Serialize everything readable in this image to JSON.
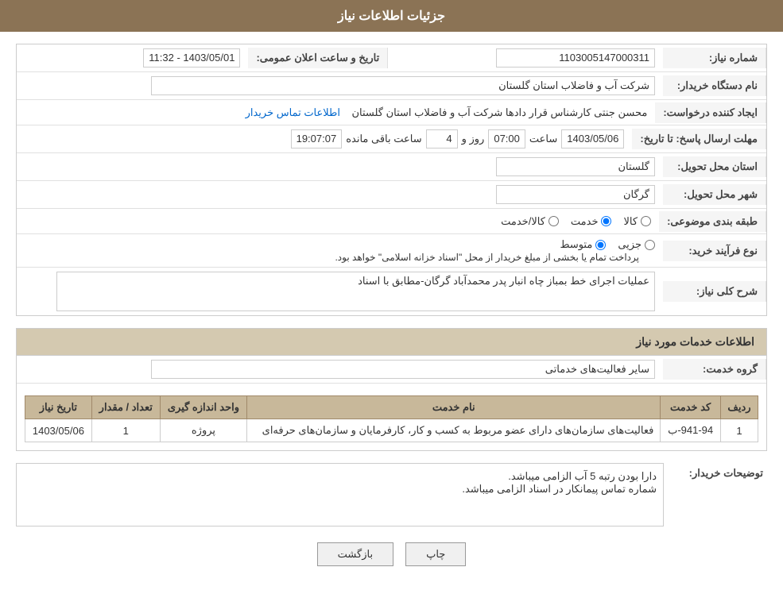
{
  "page": {
    "title": "جزئیات اطلاعات نیاز"
  },
  "header": {
    "title": "جزئیات اطلاعات نیاز"
  },
  "form": {
    "need_number_label": "شماره نیاز:",
    "need_number_value": "1103005147000311",
    "announcement_date_label": "تاریخ و ساعت اعلان عمومی:",
    "announcement_date_value": "1403/05/01 - 11:32",
    "buyer_org_label": "نام دستگاه خریدار:",
    "buyer_org_value": "شرکت آب و فاضلاب استان گلستان",
    "creator_label": "ایجاد کننده درخواست:",
    "creator_value": "محسن جنتی کارشناس قرار دادها شرکت آب و فاضلاب استان گلستان",
    "creator_link": "اطلاعات تماس خریدار",
    "reply_deadline_label": "مهلت ارسال پاسخ: تا تاریخ:",
    "reply_date": "1403/05/06",
    "reply_time_label": "ساعت",
    "reply_time": "07:00",
    "reply_day_label": "روز و",
    "reply_days": "4",
    "reply_remaining_label": "ساعت باقی مانده",
    "reply_remaining": "19:07:07",
    "province_label": "استان محل تحویل:",
    "province_value": "گلستان",
    "city_label": "شهر محل تحویل:",
    "city_value": "گرگان",
    "category_label": "طبقه بندی موضوعی:",
    "category_options": [
      "کالا",
      "خدمت",
      "کالا/خدمت"
    ],
    "category_selected": "خدمت",
    "purchase_type_label": "نوع فرآیند خرید:",
    "purchase_options": [
      "جزیی",
      "متوسط"
    ],
    "purchase_note": "پرداخت تمام یا بخشی از مبلغ خریدار از محل \"اسناد خزانه اسلامی\" خواهد بود.",
    "description_label": "شرح کلی نیاز:",
    "description_value": "عملیات اجرای خط بمباز چاه انبار پدر محمدآباد گرگان-مطابق با اسناد",
    "services_section_title": "اطلاعات خدمات مورد نیاز",
    "service_group_label": "گروه خدمت:",
    "service_group_value": "سایر فعالیت‌های خدماتی",
    "table": {
      "headers": [
        "ردیف",
        "کد خدمت",
        "نام خدمت",
        "واحد اندازه گیری",
        "تعداد / مقدار",
        "تاریخ نیاز"
      ],
      "rows": [
        {
          "row": "1",
          "code": "941-94-ب",
          "name": "فعالیت‌های سازمان‌های دارای عضو مربوط به کسب و کار، کارفرمایان و سازمان‌های حرفه‌ای",
          "unit": "پروژه",
          "quantity": "1",
          "date": "1403/05/06"
        }
      ]
    },
    "buyer_desc_label": "توضیحات خریدار:",
    "buyer_desc_value": "دارا بودن رتبه 5 آب الزامی میباشد.\nشماره تماس پیمانکار در اسناد الزامی میباشد.",
    "btn_print": "چاپ",
    "btn_back": "بازگشت"
  }
}
